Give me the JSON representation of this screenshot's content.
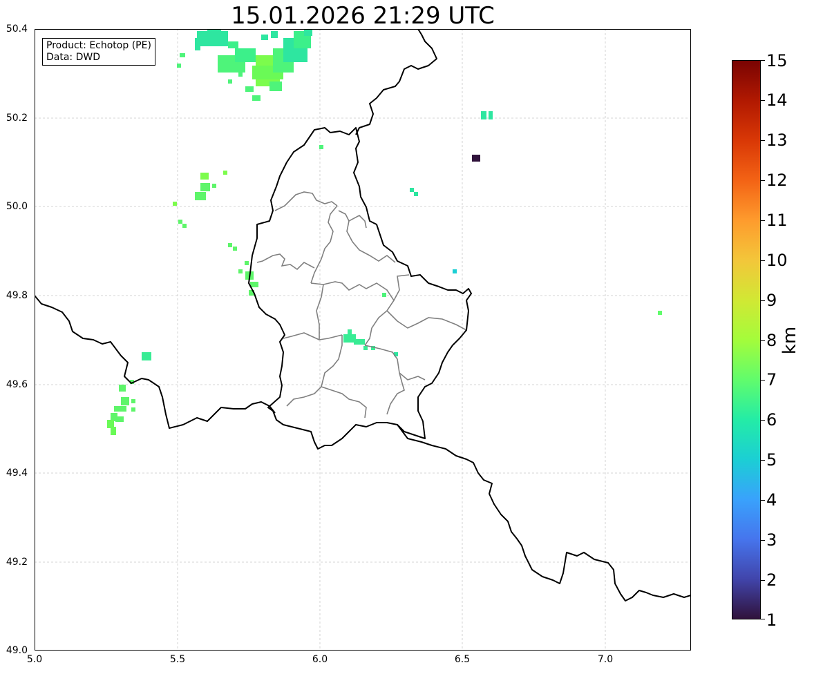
{
  "title": "15.01.2026 21:29 UTC",
  "info_box": {
    "product": "Product: Echotop (PE)",
    "data": "Data: DWD"
  },
  "map": {
    "lon_range": [
      5.0,
      7.3
    ],
    "lat_range": [
      49.0,
      50.4
    ],
    "x_ticks": [
      "5.0",
      "5.5",
      "6.0",
      "6.5",
      "7.0"
    ],
    "y_ticks": [
      "50.4",
      "50.2",
      "50.0",
      "49.8",
      "49.6",
      "49.4",
      "49.2",
      "49.0"
    ],
    "grid": true,
    "features": [
      "luxembourg-border",
      "luxembourg-cantons",
      "neighbor-borders",
      "radar-echoes"
    ]
  },
  "colorbar": {
    "label": "km",
    "ticks": [
      "15",
      "14",
      "13",
      "12",
      "11",
      "10",
      "9",
      "8",
      "7",
      "6",
      "5",
      "4",
      "3",
      "2",
      "1"
    ],
    "min": 1,
    "max": 15,
    "colormap": [
      "#30123b",
      "#4145ab",
      "#4675ed",
      "#39a2fc",
      "#1bcfd4",
      "#24eca6",
      "#61fc6c",
      "#a4fc3b",
      "#d1e834",
      "#f3c63a",
      "#fe9b2d",
      "#f36315",
      "#d93806",
      "#b11901",
      "#7a0403"
    ]
  }
}
